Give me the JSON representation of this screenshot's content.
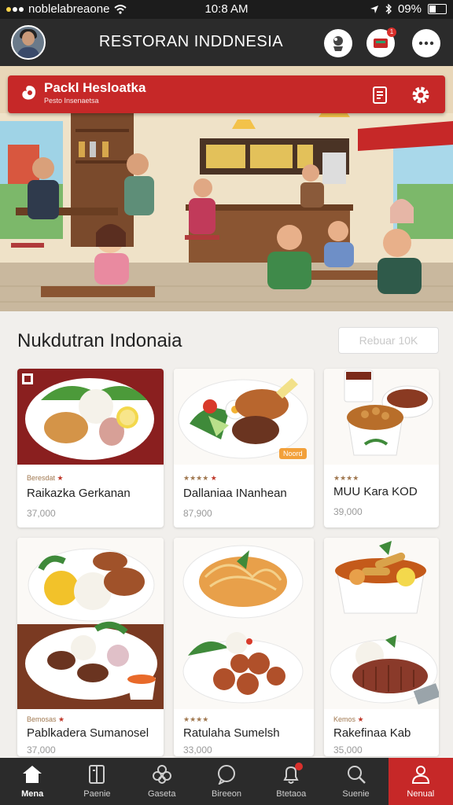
{
  "status_bar": {
    "carrier": "noblelabreaone",
    "time": "10:8 AM",
    "battery": "09%"
  },
  "app_bar": {
    "title": "RESTORAN INDDNESIA"
  },
  "hero": {
    "brand_name": "Packl Hesloatka",
    "brand_sub": "Pesto Insenaetsa"
  },
  "section": {
    "title": "Nukdutran Indonaia",
    "search_placeholder": "Rebuar 10K"
  },
  "menu_items": [
    {
      "rating": "Beresdat",
      "name": "Raikazka Gerkanan",
      "price": "37,000"
    },
    {
      "rating": "★★★★",
      "name": "Dallaniaa INanhean",
      "price": "87,900",
      "tag": "Noord"
    },
    {
      "rating": "★★★★",
      "name": "MUU Kara KOD",
      "price": "39,000"
    },
    {
      "rating": "Bemosas",
      "name": "Pablkadera Sumanosel",
      "price": "37,000"
    },
    {
      "rating": "★★★★",
      "name": "Ratulaha Sumelsh",
      "price": "33,000"
    },
    {
      "rating": "Kemos",
      "name": "Rakefinaa Kab",
      "price": "35,000"
    }
  ],
  "nav": [
    {
      "label": "Mena",
      "icon": "home-icon"
    },
    {
      "label": "Paenie",
      "icon": "book-icon"
    },
    {
      "label": "Gaseta",
      "icon": "flower-icon"
    },
    {
      "label": "Bireeon",
      "icon": "chat-icon"
    },
    {
      "label": "Btetaoa",
      "icon": "bell-icon"
    },
    {
      "label": "Suenie",
      "icon": "search-icon"
    },
    {
      "label": "Nenual",
      "icon": "user-icon"
    }
  ],
  "colors": {
    "brand_red": "#c62828",
    "bar_dark": "#2b2b2b",
    "background": "#f1efec"
  }
}
